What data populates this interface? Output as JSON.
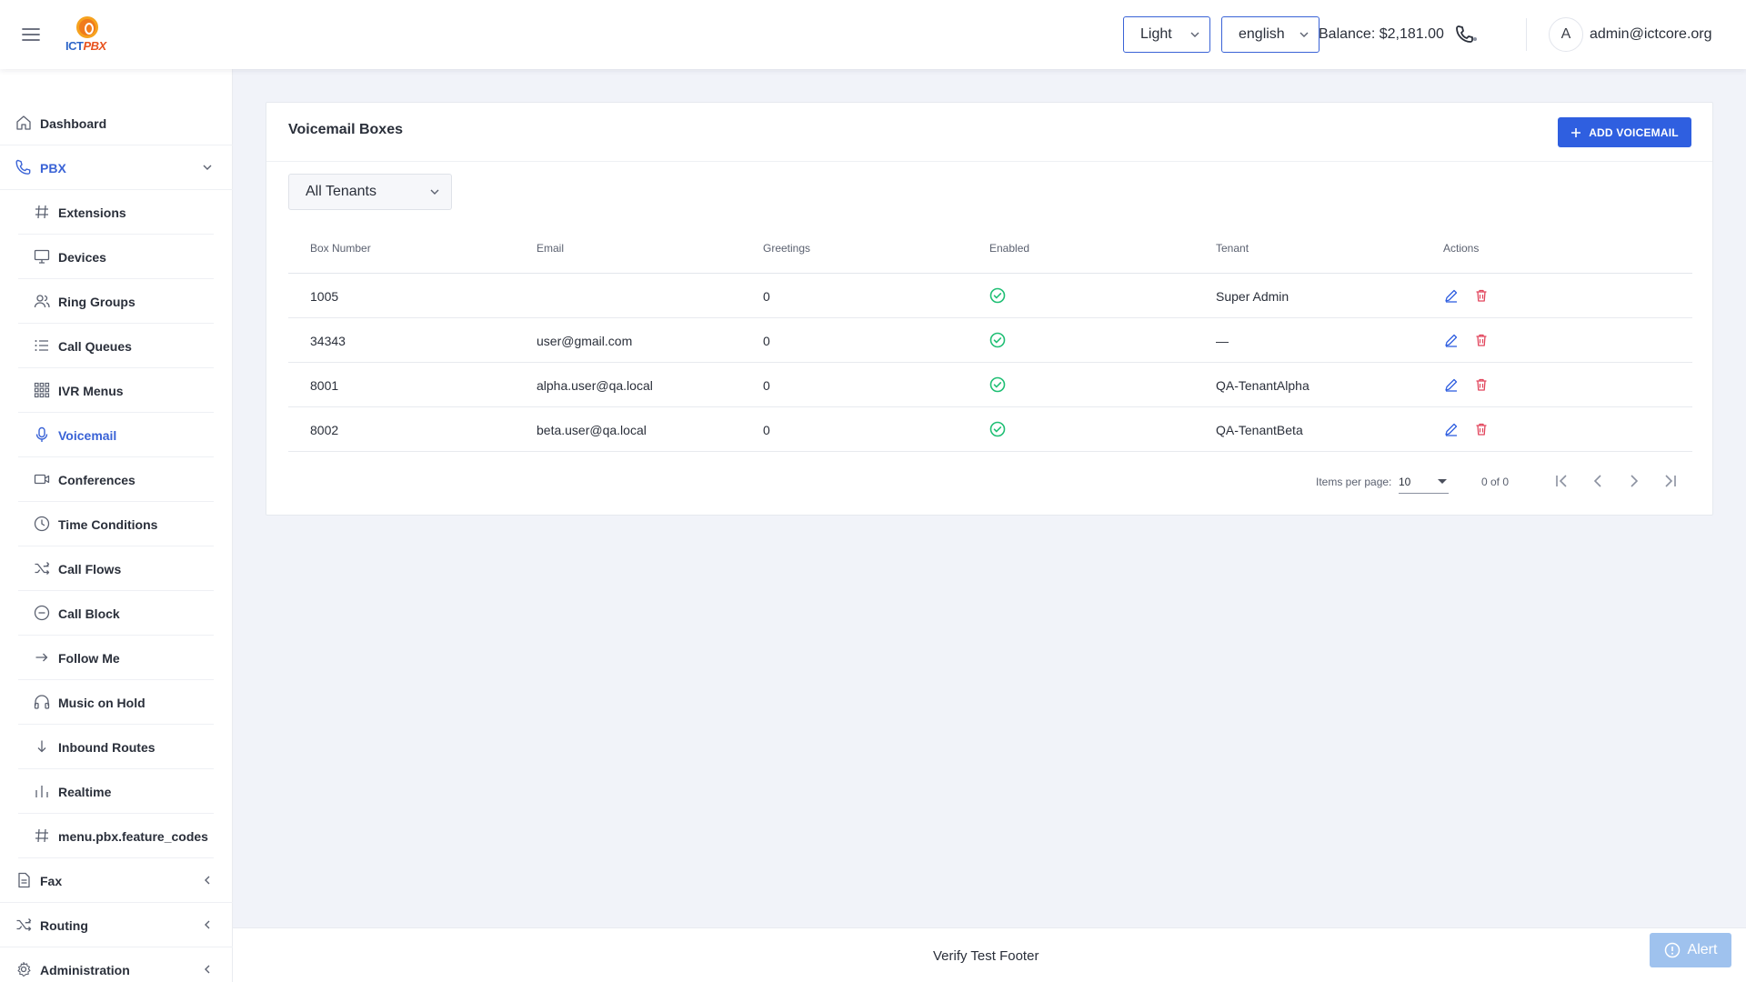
{
  "header": {
    "logo_text_ic": "ICT",
    "logo_text_pbx": "PBX",
    "theme_value": "Light",
    "language_value": "english",
    "balance": "Balance: $2,181.00",
    "avatar_initial": "A",
    "user_email": "admin@ictcore.org"
  },
  "sidebar": {
    "dashboard": "Dashboard",
    "pbx": "PBX",
    "pbx_items": [
      {
        "label": "Extensions",
        "icon": "hash-icon"
      },
      {
        "label": "Devices",
        "icon": "monitor-icon"
      },
      {
        "label": "Ring Groups",
        "icon": "users-icon"
      },
      {
        "label": "Call Queues",
        "icon": "list-icon"
      },
      {
        "label": "IVR Menus",
        "icon": "grid-icon"
      },
      {
        "label": "Voicemail",
        "icon": "mic-icon"
      },
      {
        "label": "Conferences",
        "icon": "video-icon"
      },
      {
        "label": "Time Conditions",
        "icon": "clock-icon"
      },
      {
        "label": "Call Flows",
        "icon": "shuffle-icon"
      },
      {
        "label": "Call Block",
        "icon": "minus-circle-icon"
      },
      {
        "label": "Follow Me",
        "icon": "arrow-right-icon"
      },
      {
        "label": "Music on Hold",
        "icon": "headphones-icon"
      },
      {
        "label": "Inbound Routes",
        "icon": "arrow-down-icon"
      },
      {
        "label": "Realtime",
        "icon": "bar-chart-icon"
      },
      {
        "label": "menu.pbx.feature_codes",
        "icon": "hash-icon"
      }
    ],
    "fax": "Fax",
    "routing": "Routing",
    "administration": "Administration"
  },
  "card": {
    "title": "Voicemail Boxes",
    "add_button": "ADD VOICEMAIL",
    "tenant_filter": "All Tenants"
  },
  "table": {
    "headers": {
      "box_number": "Box Number",
      "email": "Email",
      "greetings": "Greetings",
      "enabled": "Enabled",
      "tenant": "Tenant",
      "actions": "Actions"
    },
    "rows": [
      {
        "box": "1005",
        "email": "",
        "greetings": "0",
        "tenant": "Super Admin"
      },
      {
        "box": "34343",
        "email": "user@gmail.com",
        "greetings": "0",
        "tenant": "—"
      },
      {
        "box": "8001",
        "email": "alpha.user@qa.local",
        "greetings": "0",
        "tenant": "QA-TenantAlpha"
      },
      {
        "box": "8002",
        "email": "beta.user@qa.local",
        "greetings": "0",
        "tenant": "QA-TenantBeta"
      }
    ]
  },
  "paginator": {
    "items_per_page_label": "Items per page:",
    "items_per_page_value": "10",
    "range": "0 of 0"
  },
  "footer": {
    "text": "Verify Test Footer",
    "alert": "Alert"
  },
  "colors": {
    "accent": "#2f5fe0",
    "success": "#1fbf74",
    "danger": "#e2455c"
  }
}
